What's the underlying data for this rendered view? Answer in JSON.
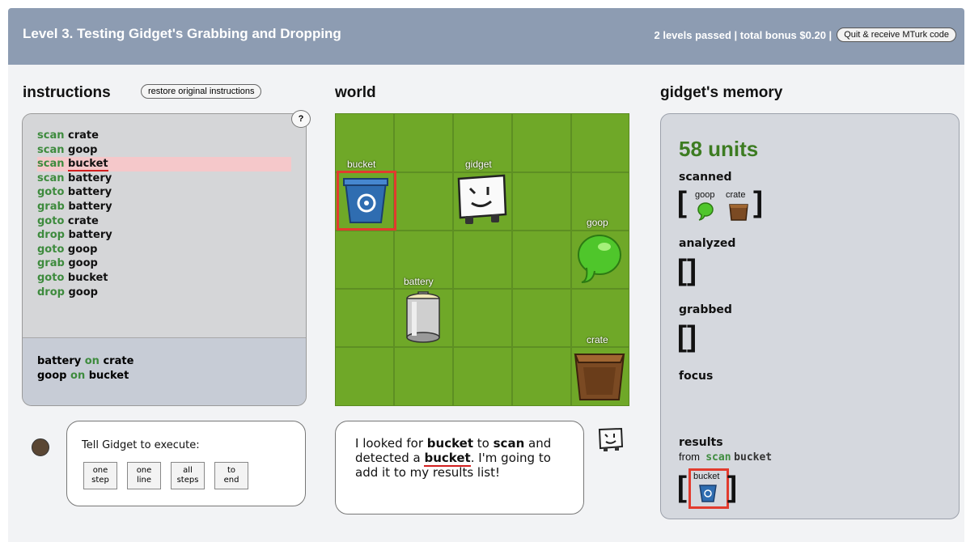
{
  "header": {
    "title": "Level 3. Testing Gidget's Grabbing and Dropping",
    "status": "2 levels passed | total bonus $0.20 |",
    "quit_label": "Quit & receive MTurk code"
  },
  "instructions": {
    "title": "instructions",
    "restore_label": "restore original instructions",
    "help": "?",
    "code_lines": [
      {
        "kw": "scan",
        "obj": "crate"
      },
      {
        "kw": "scan",
        "obj": "goop"
      },
      {
        "kw": "scan",
        "obj": "bucket",
        "highlight": true
      },
      {
        "kw": "scan",
        "obj": "battery"
      },
      {
        "kw": "goto",
        "obj": "battery"
      },
      {
        "kw": "grab",
        "obj": "battery"
      },
      {
        "kw": "goto",
        "obj": "crate"
      },
      {
        "kw": "drop",
        "obj": "battery"
      },
      {
        "kw": "goto",
        "obj": "goop"
      },
      {
        "kw": "grab",
        "obj": "goop"
      },
      {
        "kw": "goto",
        "obj": "bucket"
      },
      {
        "kw": "drop",
        "obj": "goop"
      }
    ],
    "goals": [
      {
        "a": "battery",
        "on": "on",
        "b": "crate"
      },
      {
        "a": "goop",
        "on": "on",
        "b": "bucket"
      }
    ]
  },
  "execute": {
    "label": "Tell Gidget to execute:",
    "buttons": [
      "one\nstep",
      "one\nline",
      "all\nsteps",
      "to\nend"
    ]
  },
  "world": {
    "title": "world",
    "labels": {
      "bucket": "bucket",
      "gidget": "gidget",
      "goop": "goop",
      "battery": "battery",
      "crate": "crate"
    }
  },
  "speech": {
    "p1": "I looked for ",
    "b1": "bucket",
    "p2": " to ",
    "b2": "scan",
    "p3": " and detected a ",
    "b3": "bucket",
    "p4": ". I'm going to add it to my results list!"
  },
  "memory": {
    "title": "gidget's memory",
    "units": "58 units",
    "scanned_label": "scanned",
    "scanned_items": [
      "goop",
      "crate"
    ],
    "analyzed_label": "analyzed",
    "grabbed_label": "grabbed",
    "focus_label": "focus",
    "results_label": "results",
    "results_from": "from",
    "results_kw": "scan",
    "results_obj": "bucket",
    "results_item": "bucket"
  },
  "colors": {
    "keyword": "#3e8b3e",
    "highlight": "#f5c8ca",
    "accent_red": "#e23b2e",
    "units_green": "#3d7c22"
  }
}
